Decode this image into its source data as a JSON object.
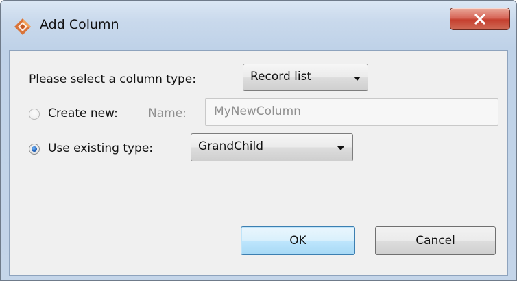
{
  "window": {
    "title": "Add Column",
    "icon": "app-diamond-icon",
    "close_icon": "close-icon",
    "accent": "#c5402f"
  },
  "form": {
    "column_type_label": "Please select a column type:",
    "column_type_value": "Record list",
    "create_new_label": "Create new:",
    "name_label": "Name:",
    "name_value": "MyNewColumn",
    "use_existing_label": "Use existing type:",
    "existing_type_value": "GrandChild",
    "create_new_selected": false,
    "use_existing_selected": true
  },
  "buttons": {
    "ok": "OK",
    "cancel": "Cancel"
  }
}
